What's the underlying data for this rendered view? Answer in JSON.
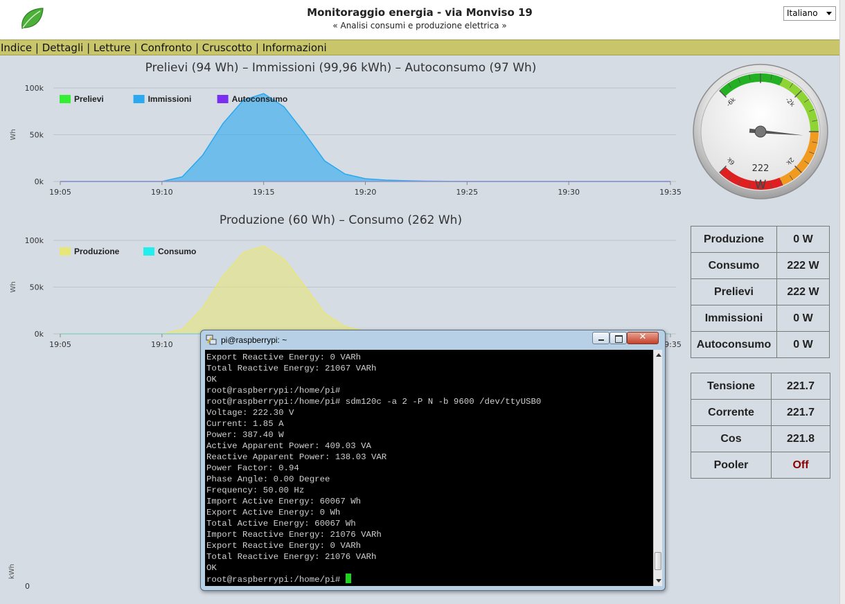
{
  "header": {
    "title": "Monitoraggio energia - via Monviso 19",
    "subtitle": "« Analisi consumi e produzione elettrica »",
    "language": "Italiano"
  },
  "nav": {
    "items": [
      "Indice",
      "Dettagli",
      "Letture",
      "Confronto",
      "Cruscotto",
      "Informazioni"
    ]
  },
  "chart_data": [
    {
      "type": "area",
      "title": "Prelievi (94 Wh) – Immissioni (99,96 kWh) – Autoconsumo (97 Wh)",
      "ylabel": "Wh",
      "ylim": [
        0,
        100000
      ],
      "yticks": [
        "0k",
        "50k",
        "100k"
      ],
      "x": [
        "19:05",
        "19:06",
        "19:07",
        "19:08",
        "19:09",
        "19:10",
        "19:11",
        "19:12",
        "19:13",
        "19:14",
        "19:15",
        "19:16",
        "19:17",
        "19:18",
        "19:19",
        "19:20",
        "19:21",
        "19:22",
        "19:23",
        "19:24",
        "19:25",
        "19:26",
        "19:27",
        "19:28",
        "19:29",
        "19:30",
        "19:31",
        "19:32",
        "19:33",
        "19:34",
        "19:35"
      ],
      "xticks": [
        "19:05",
        "19:10",
        "19:15",
        "19:20",
        "19:25",
        "19:30",
        "19:35"
      ],
      "legend_position": "top-left",
      "grid": true,
      "series": [
        {
          "name": "Prelievi",
          "color": "#33ee33",
          "values": [
            0,
            0,
            0,
            0,
            0,
            0,
            0,
            0,
            0,
            0,
            0,
            0,
            0,
            0,
            0,
            0,
            0,
            0,
            0,
            0,
            0,
            0,
            0,
            0,
            0,
            0,
            0,
            0,
            0,
            0,
            0
          ]
        },
        {
          "name": "Immissioni",
          "color": "#2aa8f0",
          "values": [
            0,
            0,
            0,
            0,
            0,
            0,
            5000,
            28000,
            62000,
            87000,
            94000,
            80000,
            52000,
            22000,
            8000,
            3000,
            1500,
            800,
            400,
            200,
            0,
            0,
            0,
            0,
            0,
            0,
            0,
            0,
            0,
            0,
            0
          ]
        },
        {
          "name": "Autoconsumo",
          "color": "#7a2ef0",
          "values": [
            0,
            0,
            0,
            0,
            0,
            0,
            0,
            0,
            0,
            0,
            0,
            0,
            0,
            0,
            0,
            0,
            0,
            0,
            0,
            0,
            0,
            0,
            0,
            0,
            0,
            0,
            0,
            0,
            0,
            0,
            0
          ]
        }
      ]
    },
    {
      "type": "area",
      "title": "Produzione (60 Wh) – Consumo (262 Wh)",
      "ylabel": "Wh",
      "ylim": [
        0,
        100000
      ],
      "yticks": [
        "0k",
        "50k",
        "100k"
      ],
      "x": [
        "19:05",
        "19:06",
        "19:07",
        "19:08",
        "19:09",
        "19:10",
        "19:11",
        "19:12",
        "19:13",
        "19:14",
        "19:15",
        "19:16",
        "19:17",
        "19:18",
        "19:19",
        "19:20",
        "19:21",
        "19:22",
        "19:23",
        "19:24",
        "19:25",
        "19:26",
        "19:27",
        "19:28",
        "19:29",
        "19:30",
        "19:31",
        "19:32",
        "19:33",
        "19:34",
        "19:35"
      ],
      "xticks": [
        "19:05",
        "19:10",
        "19:15",
        "19:20",
        "19:25",
        "19:30",
        "19:35"
      ],
      "legend_position": "top-left",
      "grid": true,
      "series": [
        {
          "name": "Produzione",
          "color": "#e6e67a",
          "values": [
            0,
            0,
            0,
            0,
            0,
            0,
            5000,
            28000,
            62000,
            87000,
            94000,
            80000,
            52000,
            22000,
            8000,
            3000,
            1500,
            800,
            400,
            200,
            0,
            0,
            0,
            0,
            0,
            0,
            0,
            0,
            0,
            0,
            0
          ]
        },
        {
          "name": "Consumo",
          "color": "#22eeee",
          "values": [
            0,
            0,
            0,
            0,
            0,
            0,
            0,
            0,
            0,
            0,
            0,
            0,
            0,
            0,
            0,
            0,
            0,
            0,
            0,
            0,
            0,
            0,
            0,
            0,
            0,
            0,
            0,
            0,
            0,
            0,
            0
          ]
        }
      ]
    }
  ],
  "gauge": {
    "value": 222,
    "display": "222",
    "unit": "W",
    "min": -6000,
    "max": 6000,
    "tick_labels": [
      "-6k",
      "-2k",
      "2k",
      "6k"
    ]
  },
  "stats1": [
    {
      "label": "Produzione",
      "value": "0 W"
    },
    {
      "label": "Consumo",
      "value": "222 W"
    },
    {
      "label": "Prelievi",
      "value": "222 W"
    },
    {
      "label": "Immissioni",
      "value": "0 W"
    },
    {
      "label": "Autoconsumo",
      "value": "0 W"
    }
  ],
  "stats2": [
    {
      "label": "Tensione",
      "value": "221.7"
    },
    {
      "label": "Corrente",
      "value": "221.7"
    },
    {
      "label": "Cos",
      "value": "221.8"
    },
    {
      "label": "Pooler",
      "value": "Off"
    }
  ],
  "bottom_axis": {
    "ylabel": "kWh",
    "zero": "0"
  },
  "terminal": {
    "title": "pi@raspberrypi: ~",
    "lines": [
      "Export Reactive Energy: 0 VARh",
      "Total Reactive Energy: 21067 VARh",
      "OK",
      "root@raspberrypi:/home/pi#",
      "root@raspberrypi:/home/pi# sdm120c -a 2 -P N -b 9600 /dev/ttyUSB0",
      "Voltage: 222.30 V",
      "Current: 1.85 A",
      "Power: 387.40 W",
      "Active Apparent Power: 409.03 VA",
      "Reactive Apparent Power: 138.03 VAR",
      "Power Factor: 0.94",
      "Phase Angle: 0.00 Degree",
      "Frequency: 50.00 Hz",
      "Import Active Energy: 60067 Wh",
      "Export Active Energy: 0 Wh",
      "Total Active Energy: 60067 Wh",
      "Import Reactive Energy: 21076 VARh",
      "Export Reactive Energy: 0 VARh",
      "Total Reactive Energy: 21076 VARh",
      "OK"
    ],
    "prompt": "root@raspberrypi:/home/pi# "
  }
}
